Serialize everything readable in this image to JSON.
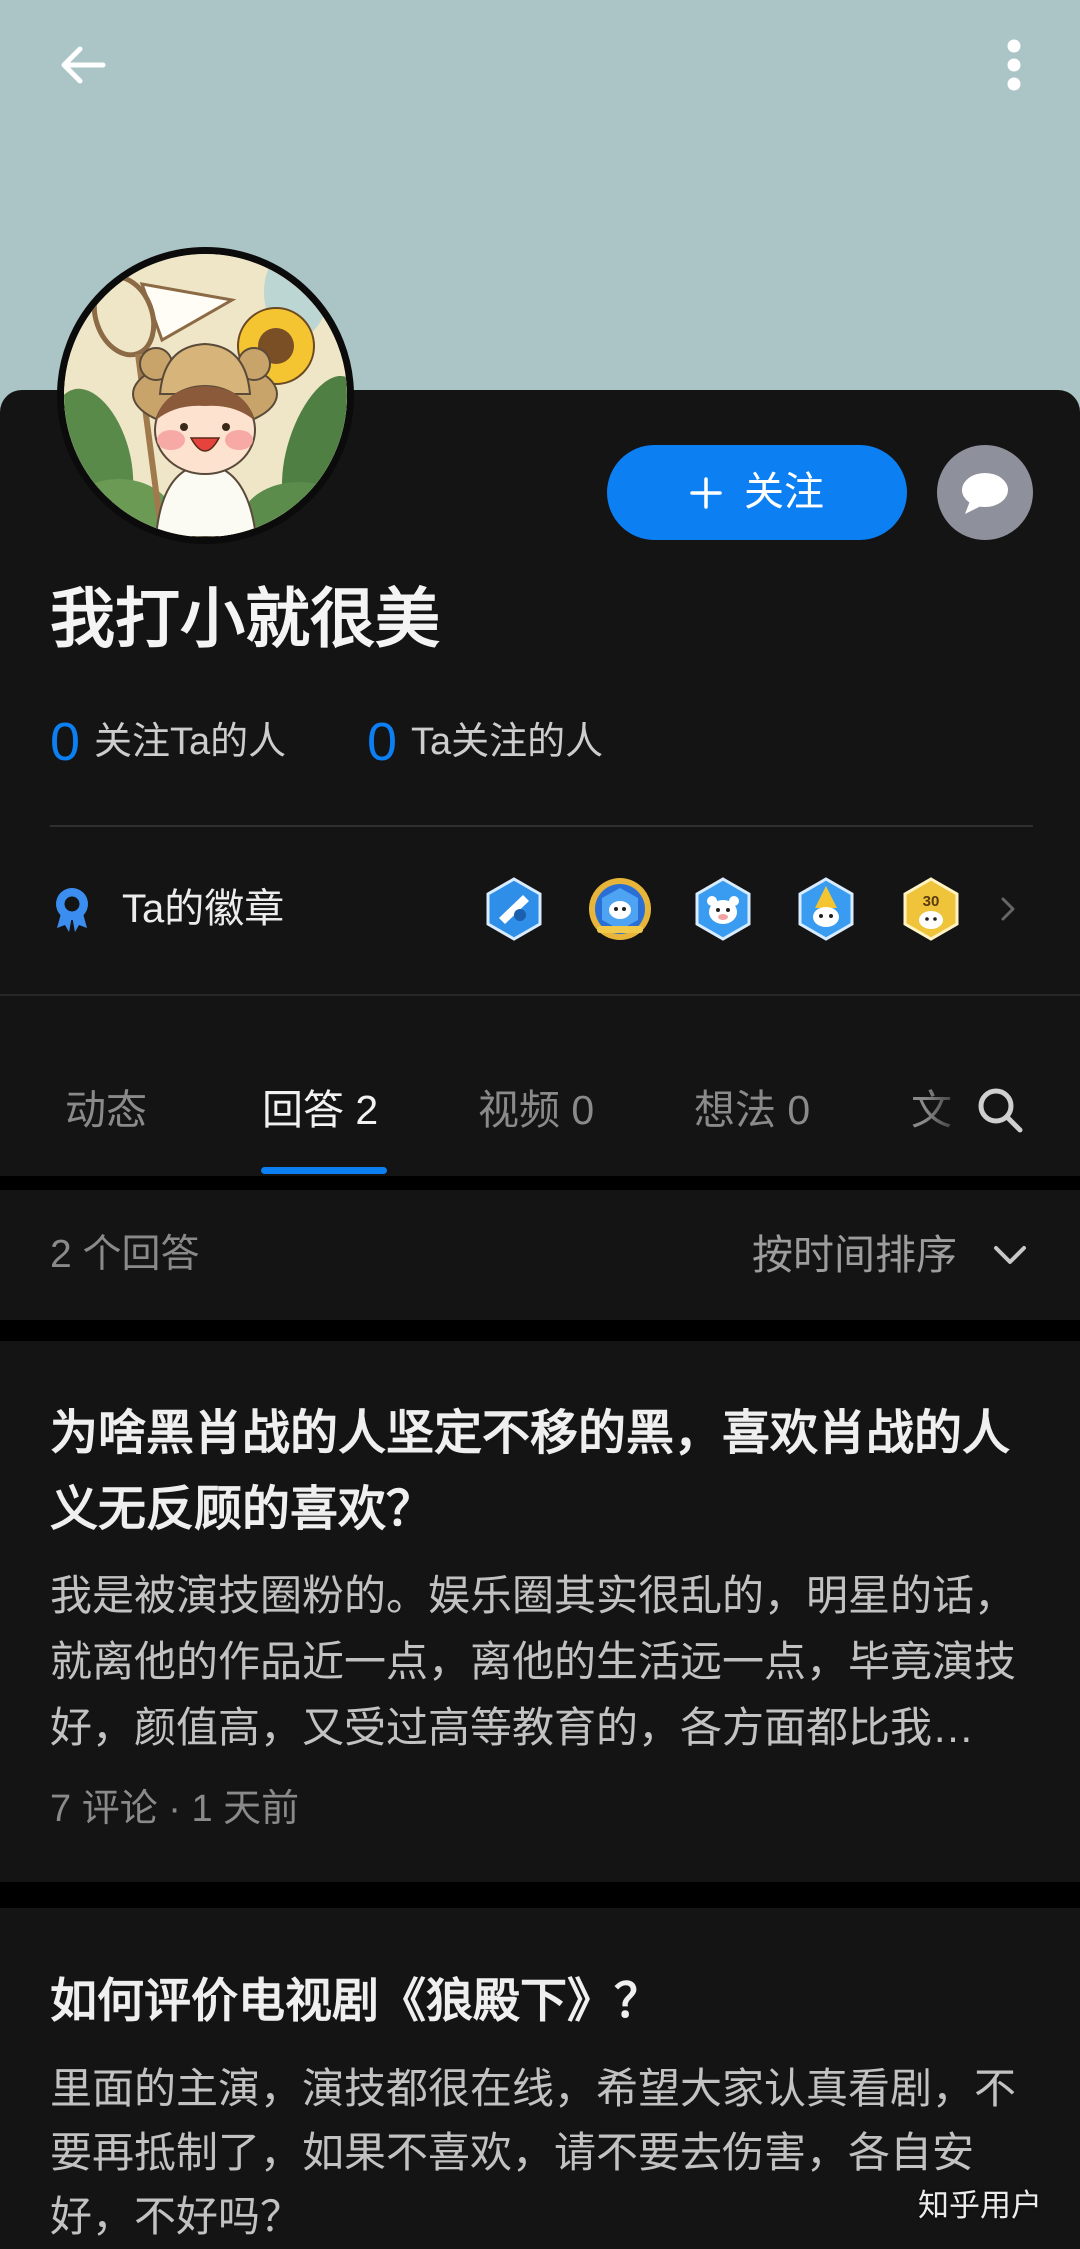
{
  "colors": {
    "accent": "#0c7ff2",
    "header_bg": "#abc4c6",
    "card_bg": "#141414",
    "page_bg": "#000000"
  },
  "header": {
    "back_icon": "arrow-left-icon",
    "more_icon": "more-vertical-icon"
  },
  "profile": {
    "name": "我打小就很美",
    "follow_button": {
      "icon": "plus-icon",
      "label": "关注"
    },
    "message_button": {
      "icon": "chat-bubble-icon"
    },
    "stats": [
      {
        "value": "0",
        "label": "关注Ta的人"
      },
      {
        "value": "0",
        "label": "Ta关注的人"
      }
    ],
    "badges": {
      "icon": "badge-ribbon-icon",
      "label": "Ta的徽章",
      "items": [
        {
          "icon": "badge-blue-icon"
        },
        {
          "icon": "badge-laurel-icon"
        },
        {
          "icon": "badge-mascot-icon"
        },
        {
          "icon": "badge-party-hat-icon"
        },
        {
          "icon": "badge-gold-icon",
          "text": "30"
        }
      ],
      "more_icon": "chevron-right-icon"
    }
  },
  "tabs": {
    "items": [
      {
        "label": "动态",
        "active": false
      },
      {
        "label": "回答 2",
        "active": true
      },
      {
        "label": "视频 0",
        "active": false
      },
      {
        "label": "想法 0",
        "active": false
      },
      {
        "label": "文",
        "active": false
      }
    ],
    "search_icon": "search-icon"
  },
  "sort_bar": {
    "count_label": "2 个回答",
    "sort_label": "按时间排序",
    "sort_icon": "chevron-down-icon"
  },
  "answers": [
    {
      "title_lines": [
        "为啥黑肖战的人坚定不移的黑，喜欢肖战的人",
        "义无反顾的喜欢？"
      ],
      "excerpt_lines": [
        "我是被演技圈粉的。娱乐圈其实很乱的，明星的话，",
        "就离他的作品近一点，离他的生活远一点，毕竟演技",
        "好，颜值高，又受过高等教育的，各方面都比我…"
      ],
      "meta": "7 评论 · 1 天前"
    },
    {
      "title_lines": [
        "如何评价电视剧《狼殿下》？"
      ],
      "excerpt_lines": [
        "里面的主演，演技都很在线，希望大家认真看剧，不",
        "要再抵制了，如果不喜欢，请不要去伤害，各自安",
        "好，不好吗？"
      ]
    }
  ],
  "watermark": "知乎用户"
}
